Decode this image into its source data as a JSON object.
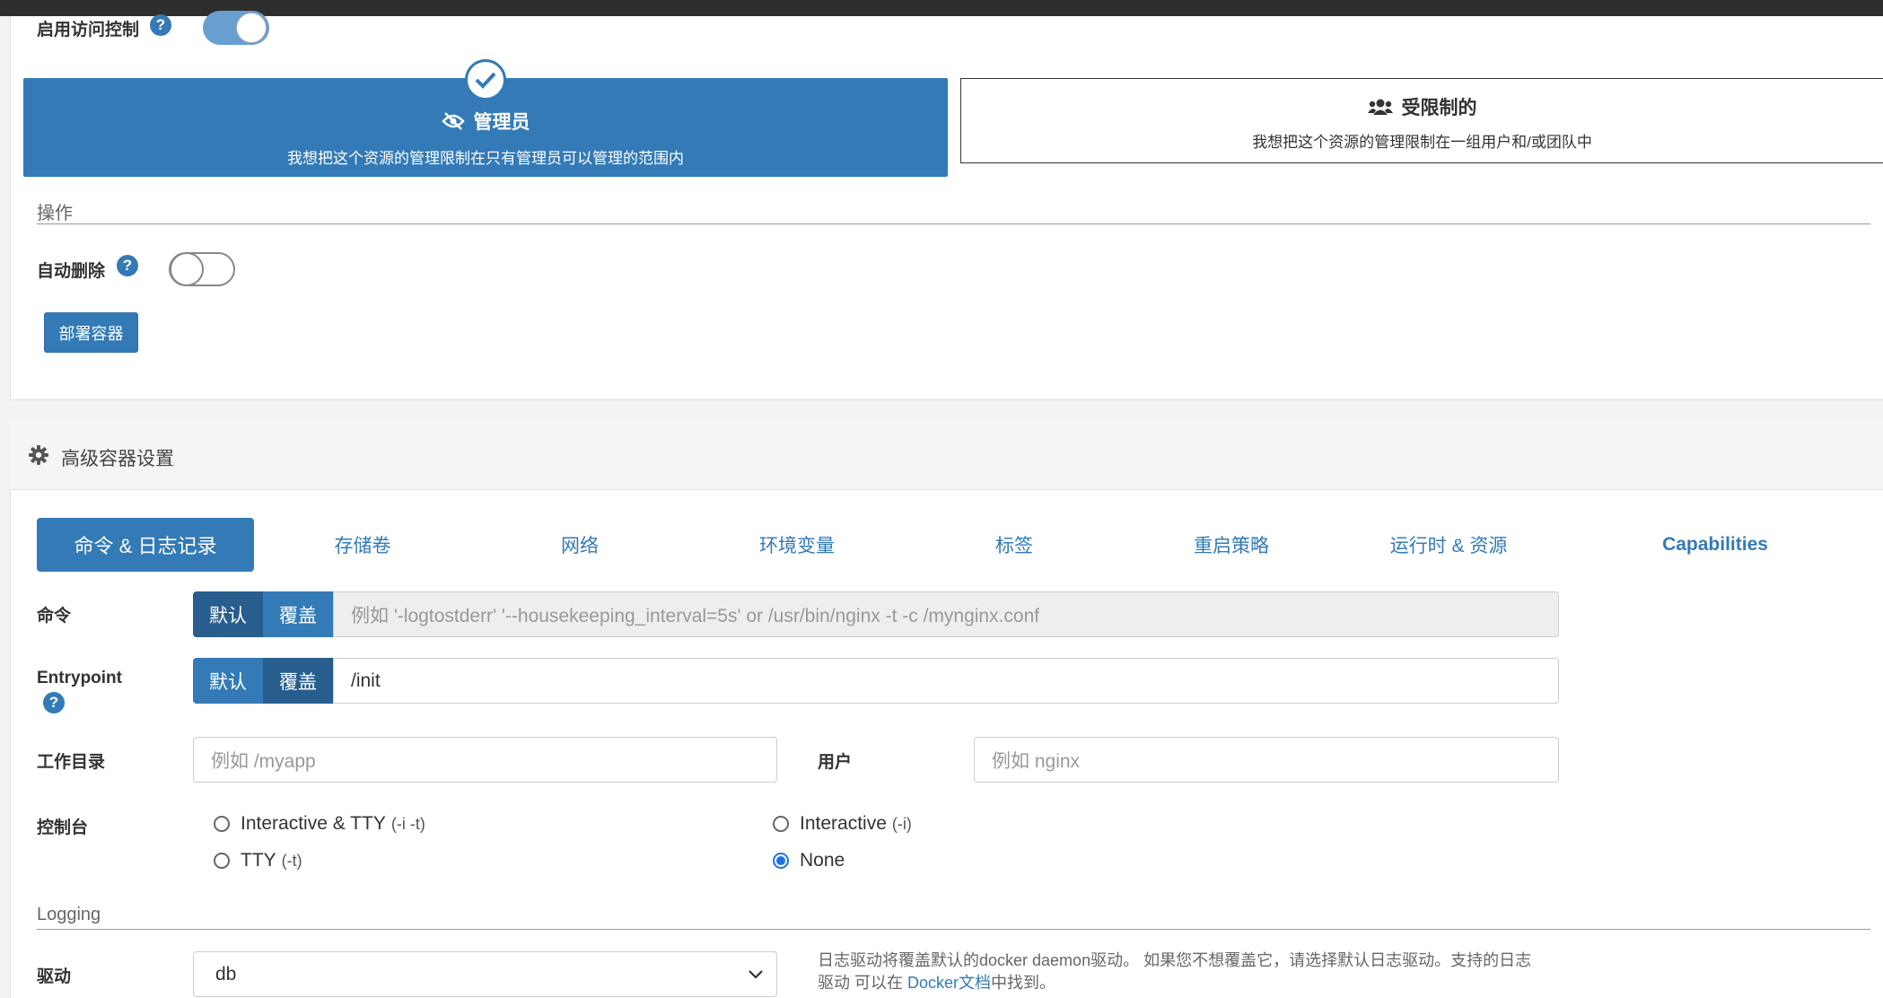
{
  "access_control": {
    "label": "启用访问控制",
    "enabled": true,
    "admin_card": {
      "title": "管理员",
      "description": "我想把这个资源的管理限制在只有管理员可以管理的范围内",
      "selected": true
    },
    "restricted_card": {
      "title": "受限制的",
      "description": "我想把这个资源的管理限制在一组用户和/或团队中"
    }
  },
  "actions": {
    "section_title": "操作",
    "auto_remove_label": "自动删除",
    "auto_remove_enabled": false,
    "deploy_button": "部署容器"
  },
  "advanced": {
    "header": "高级容器设置",
    "tabs": [
      "命令 & 日志记录",
      "存储卷",
      "网络",
      "环境变量",
      "标签",
      "重启策略",
      "运行时 & 资源",
      "Capabilities"
    ],
    "active_tab": 0
  },
  "form": {
    "command": {
      "label": "命令",
      "default_label": "默认",
      "override_label": "覆盖",
      "placeholder": "例如 '-logtostderr' '--housekeeping_interval=5s' or /usr/bin/nginx -t -c /mynginx.conf"
    },
    "entrypoint": {
      "label": "Entrypoint",
      "default_label": "默认",
      "override_label": "覆盖",
      "value": "/init"
    },
    "workdir": {
      "label": "工作目录",
      "placeholder": "例如 /myapp"
    },
    "user": {
      "label": "用户",
      "placeholder": "例如 nginx"
    },
    "console": {
      "label": "控制台",
      "options": [
        {
          "name": "Interactive & TTY",
          "flag": "(-i -t)",
          "checked": false
        },
        {
          "name": "Interactive",
          "flag": "(-i)",
          "checked": false
        },
        {
          "name": "TTY",
          "flag": "(-t)",
          "checked": false
        },
        {
          "name": "None",
          "flag": "",
          "checked": true
        }
      ]
    }
  },
  "logging": {
    "section_title": "Logging",
    "driver_label": "驱动",
    "driver_value": "db",
    "help_part1": "日志驱动将覆盖默认的docker daemon驱动。 如果您不想覆盖它，请选择默认日志驱动。支持的日志",
    "help_part2": "驱动 可以在 ",
    "help_link": "Docker文档",
    "help_part3": "中找到。"
  },
  "colors": {
    "primary": "#337ab7",
    "primary_dark": "#285e8e",
    "radio_checked": "#1a73e8"
  }
}
